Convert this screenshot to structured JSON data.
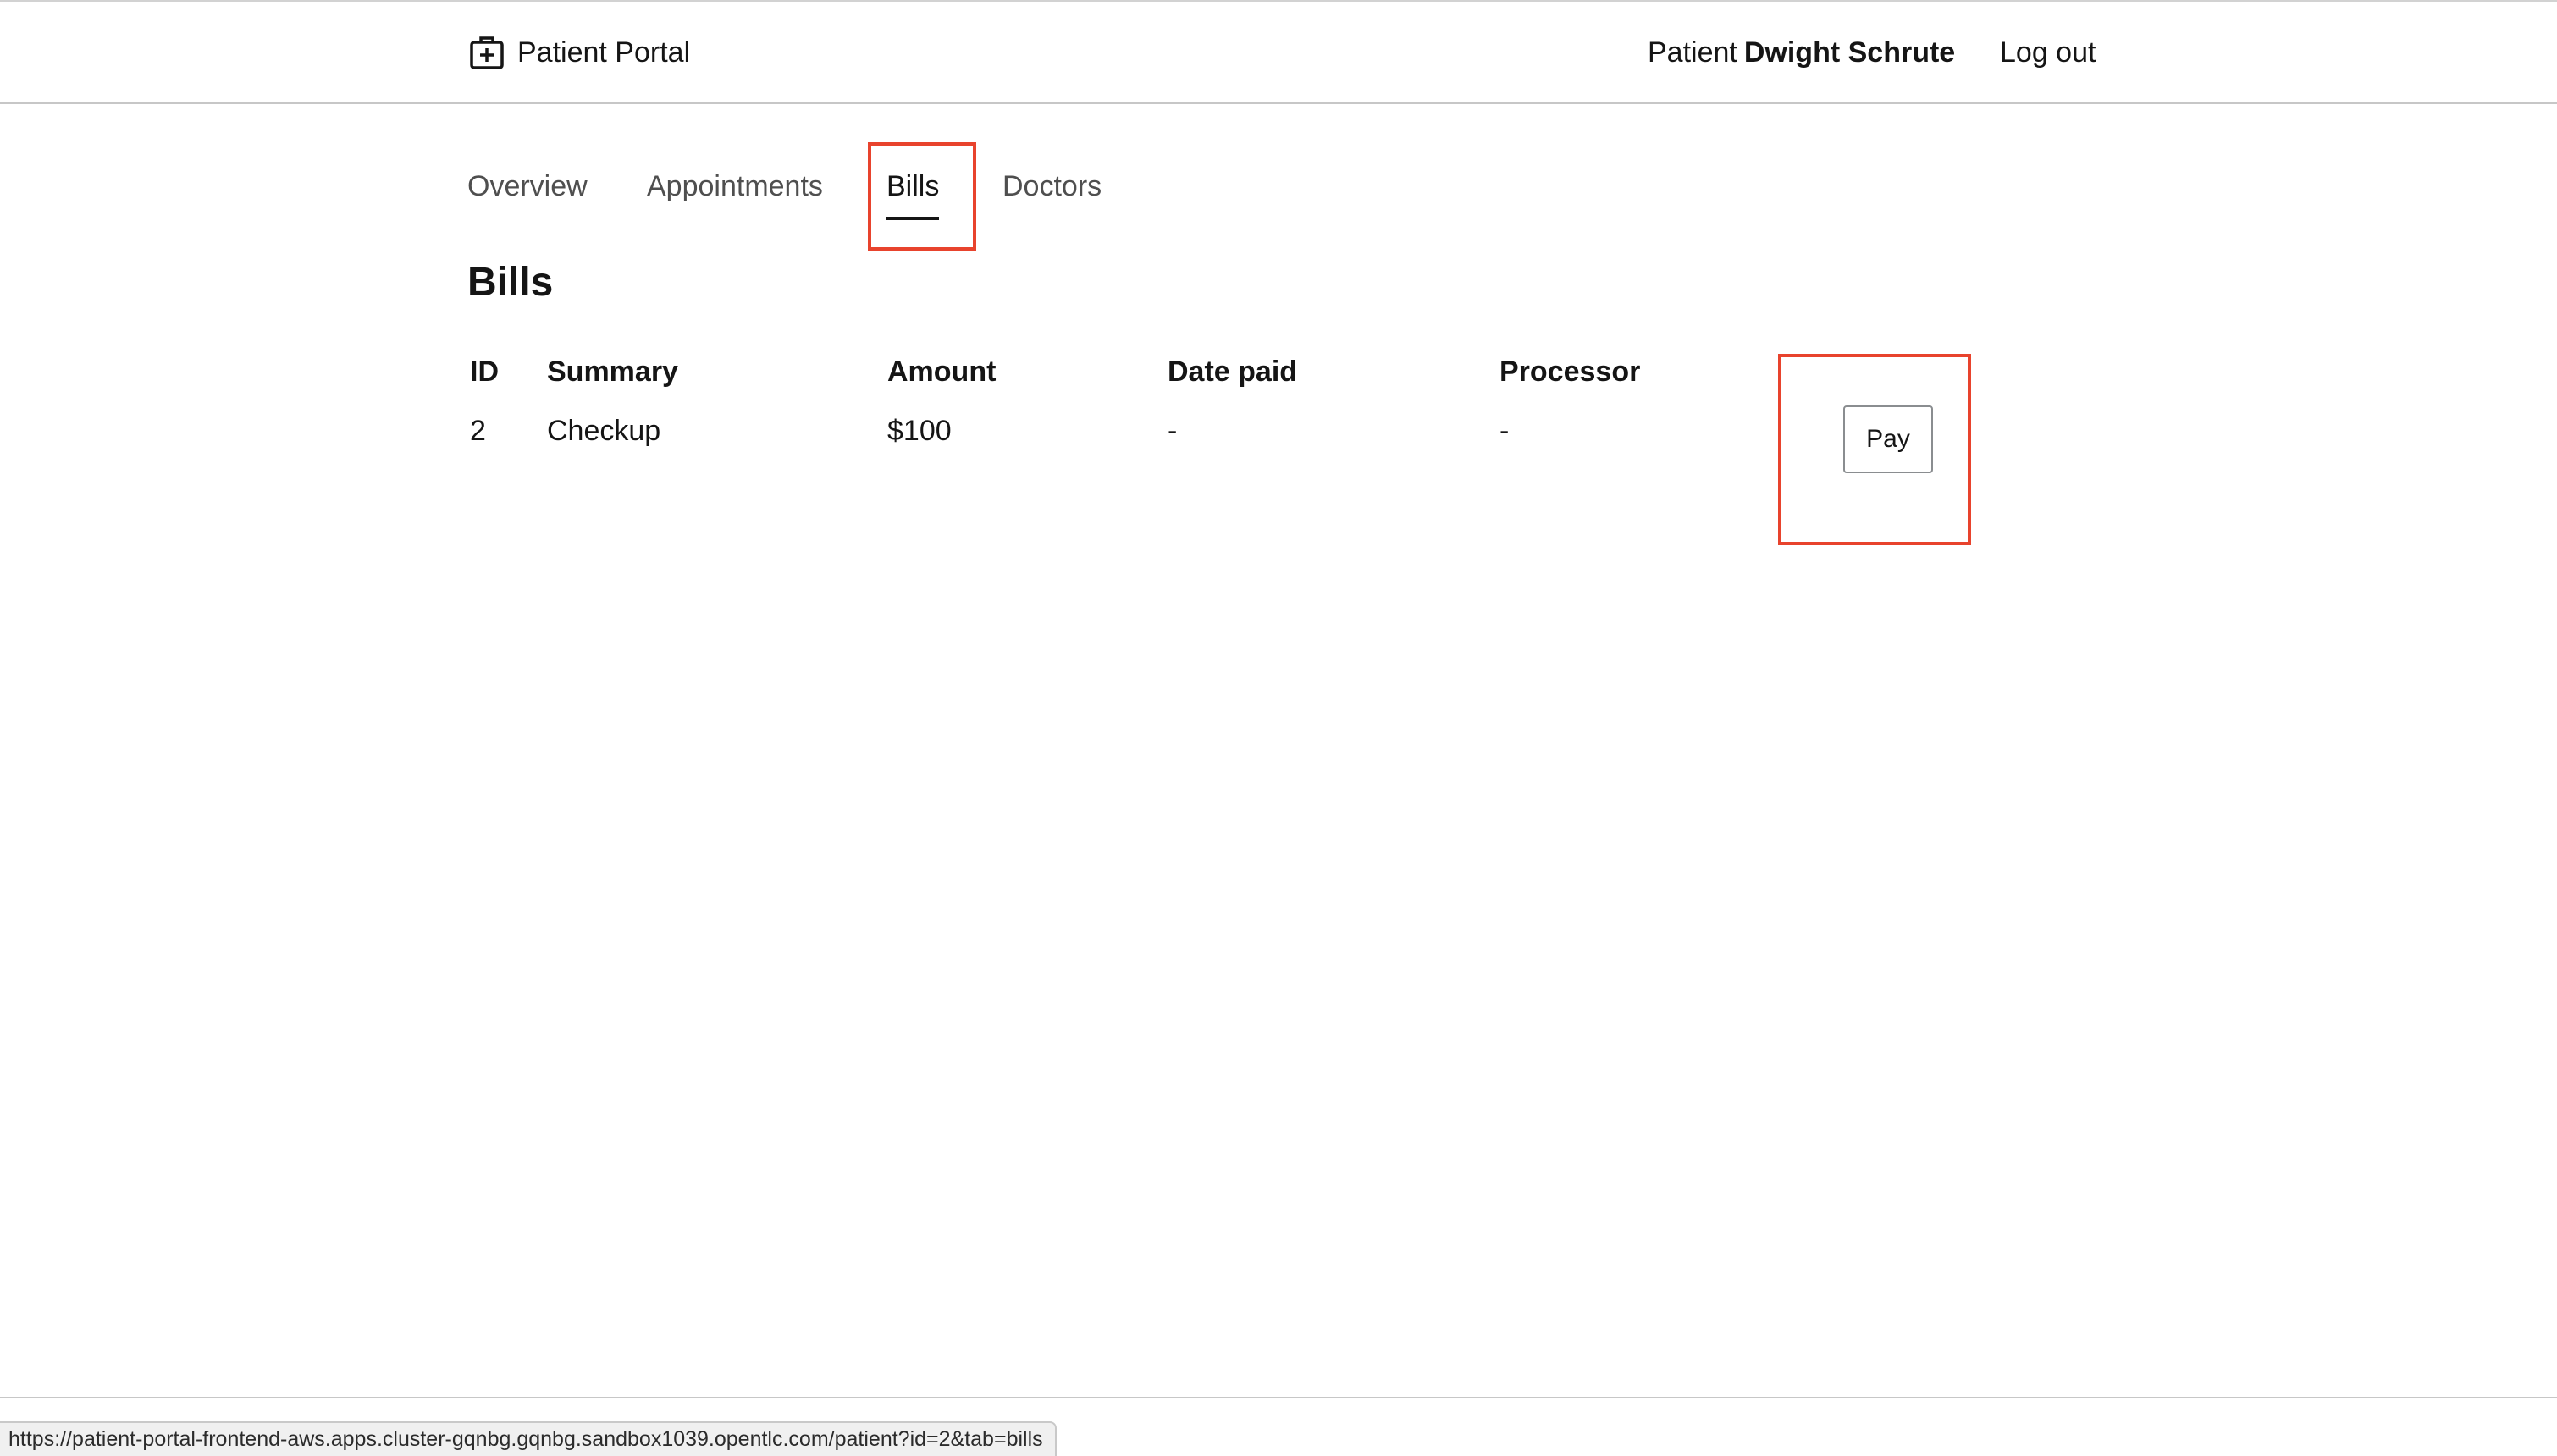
{
  "header": {
    "app_name": "Patient Portal",
    "brand_icon": "medical-briefcase-icon",
    "user_role": "Patient",
    "user_name": "Dwight Schrute",
    "logout_label": "Log out"
  },
  "tabs": [
    {
      "label": "Overview",
      "active": false
    },
    {
      "label": "Appointments",
      "active": false
    },
    {
      "label": "Bills",
      "active": true
    },
    {
      "label": "Doctors",
      "active": false
    }
  ],
  "main": {
    "title": "Bills",
    "table": {
      "columns": [
        "ID",
        "Summary",
        "Amount",
        "Date paid",
        "Processor"
      ],
      "rows": [
        {
          "id": "2",
          "summary": "Checkup",
          "amount": "$100",
          "date_paid": "-",
          "processor": "-",
          "action_label": "Pay"
        }
      ]
    }
  },
  "status_bar": {
    "url": "https://patient-portal-frontend-aws.apps.cluster-gqnbg.gqnbg.sandbox1039.opentlc.com/patient?id=2&tab=bills"
  },
  "colors": {
    "highlight": "#e8432d",
    "text": "#151515",
    "tab_inactive": "#4f4f4f"
  }
}
